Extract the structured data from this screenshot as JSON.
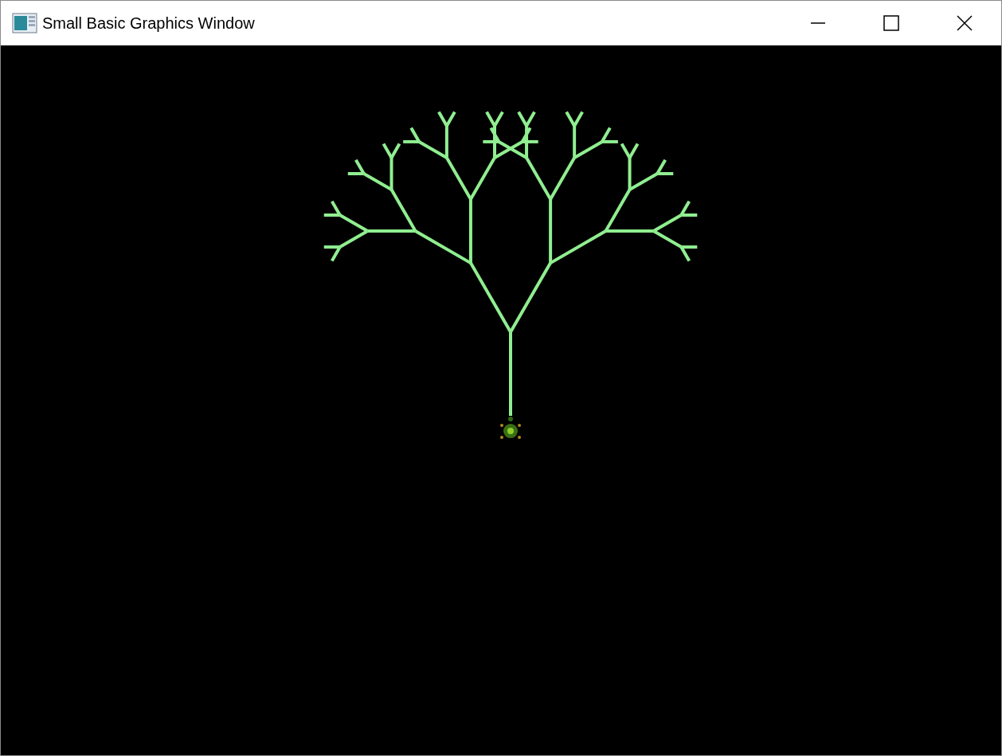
{
  "window": {
    "title": "Small Basic Graphics Window"
  }
}
